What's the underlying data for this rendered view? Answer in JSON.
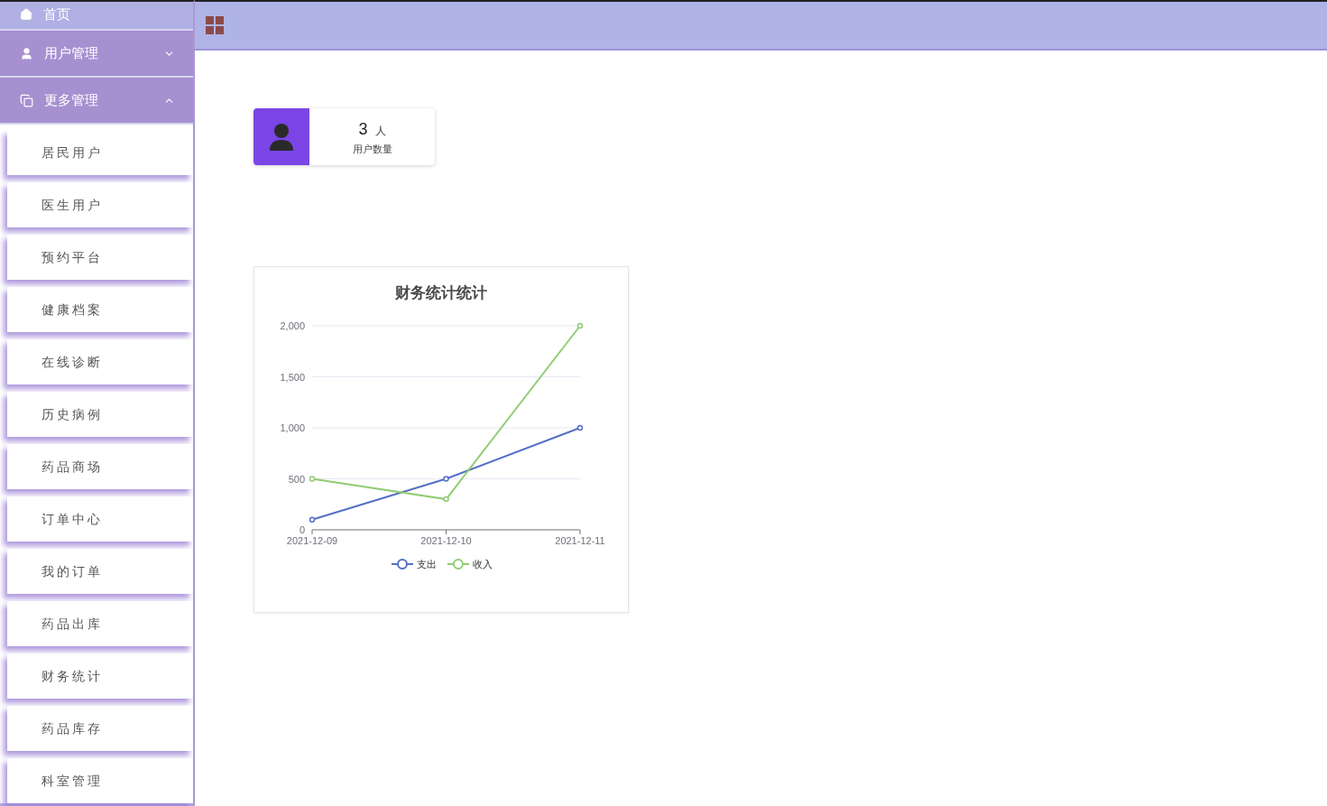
{
  "sidebar": {
    "items": [
      {
        "label": "首页",
        "kind": "link"
      },
      {
        "label": "用户管理",
        "kind": "group",
        "expanded": false
      },
      {
        "label": "更多管理",
        "kind": "group",
        "expanded": true,
        "children": [
          {
            "label": "居民用户"
          },
          {
            "label": "医生用户"
          },
          {
            "label": "预约平台"
          },
          {
            "label": "健康档案"
          },
          {
            "label": "在线诊断"
          },
          {
            "label": "历史病例"
          },
          {
            "label": "药品商场"
          },
          {
            "label": "订单中心"
          },
          {
            "label": "我的订单"
          },
          {
            "label": "药品出库"
          },
          {
            "label": "财务统计"
          },
          {
            "label": "药品库存"
          },
          {
            "label": "科室管理"
          }
        ]
      }
    ]
  },
  "stat_card": {
    "value": "3",
    "unit": "人",
    "label": "用户数量"
  },
  "chart_card": {
    "chart_data": {
      "type": "line",
      "title": "财务统计统计",
      "categories": [
        "2021-12-09",
        "2021-12-10",
        "2021-12-11"
      ],
      "grid": true,
      "legend": "bottom",
      "ylim": [
        0,
        2000
      ],
      "yticks": [
        {
          "value": 0,
          "label": "0"
        },
        {
          "value": 500,
          "label": "500"
        },
        {
          "value": 1000,
          "label": "1,000"
        },
        {
          "value": 1500,
          "label": "1,500"
        },
        {
          "value": 2000,
          "label": "2,000"
        }
      ],
      "series": [
        {
          "name": "支出",
          "color": "#5470c6",
          "marker": "circle",
          "values": [
            100,
            500,
            1000
          ]
        },
        {
          "name": "收入",
          "color": "#91cc75",
          "marker": "circle",
          "values": [
            500,
            300,
            2000
          ]
        }
      ]
    }
  }
}
